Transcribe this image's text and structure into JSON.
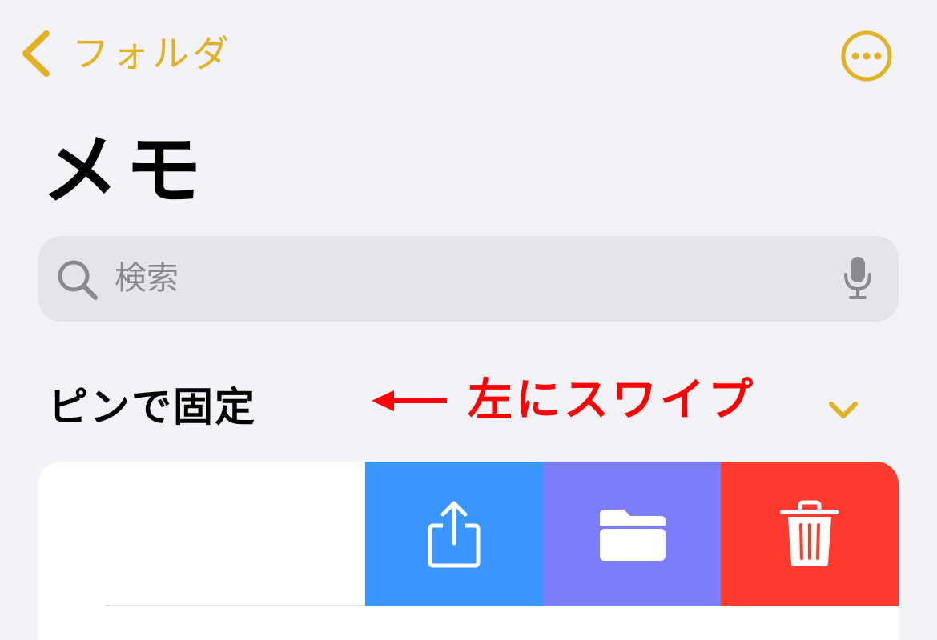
{
  "nav": {
    "back_label": "フォルダ",
    "accent_color": "#e1b221",
    "more_icon": "ellipsis-circle-icon"
  },
  "page": {
    "title": "メモ"
  },
  "search": {
    "placeholder": "検索",
    "value": "",
    "icon": "search-icon",
    "mic_icon": "microphone-icon"
  },
  "section": {
    "title": "ピンで固定",
    "collapse_icon": "chevron-down-icon"
  },
  "annotation": {
    "text": "左にスワイプ",
    "color": "#ff0000",
    "arrow_icon": "arrow-left-icon"
  },
  "note": {
    "title_peek": "",
    "swipe_actions": [
      {
        "name": "share",
        "icon": "share-icon",
        "color": "#3a95fc"
      },
      {
        "name": "move",
        "icon": "folder-icon",
        "color": "#7b7dfa"
      },
      {
        "name": "delete",
        "icon": "trash-icon",
        "color": "#ff3b30"
      }
    ]
  }
}
